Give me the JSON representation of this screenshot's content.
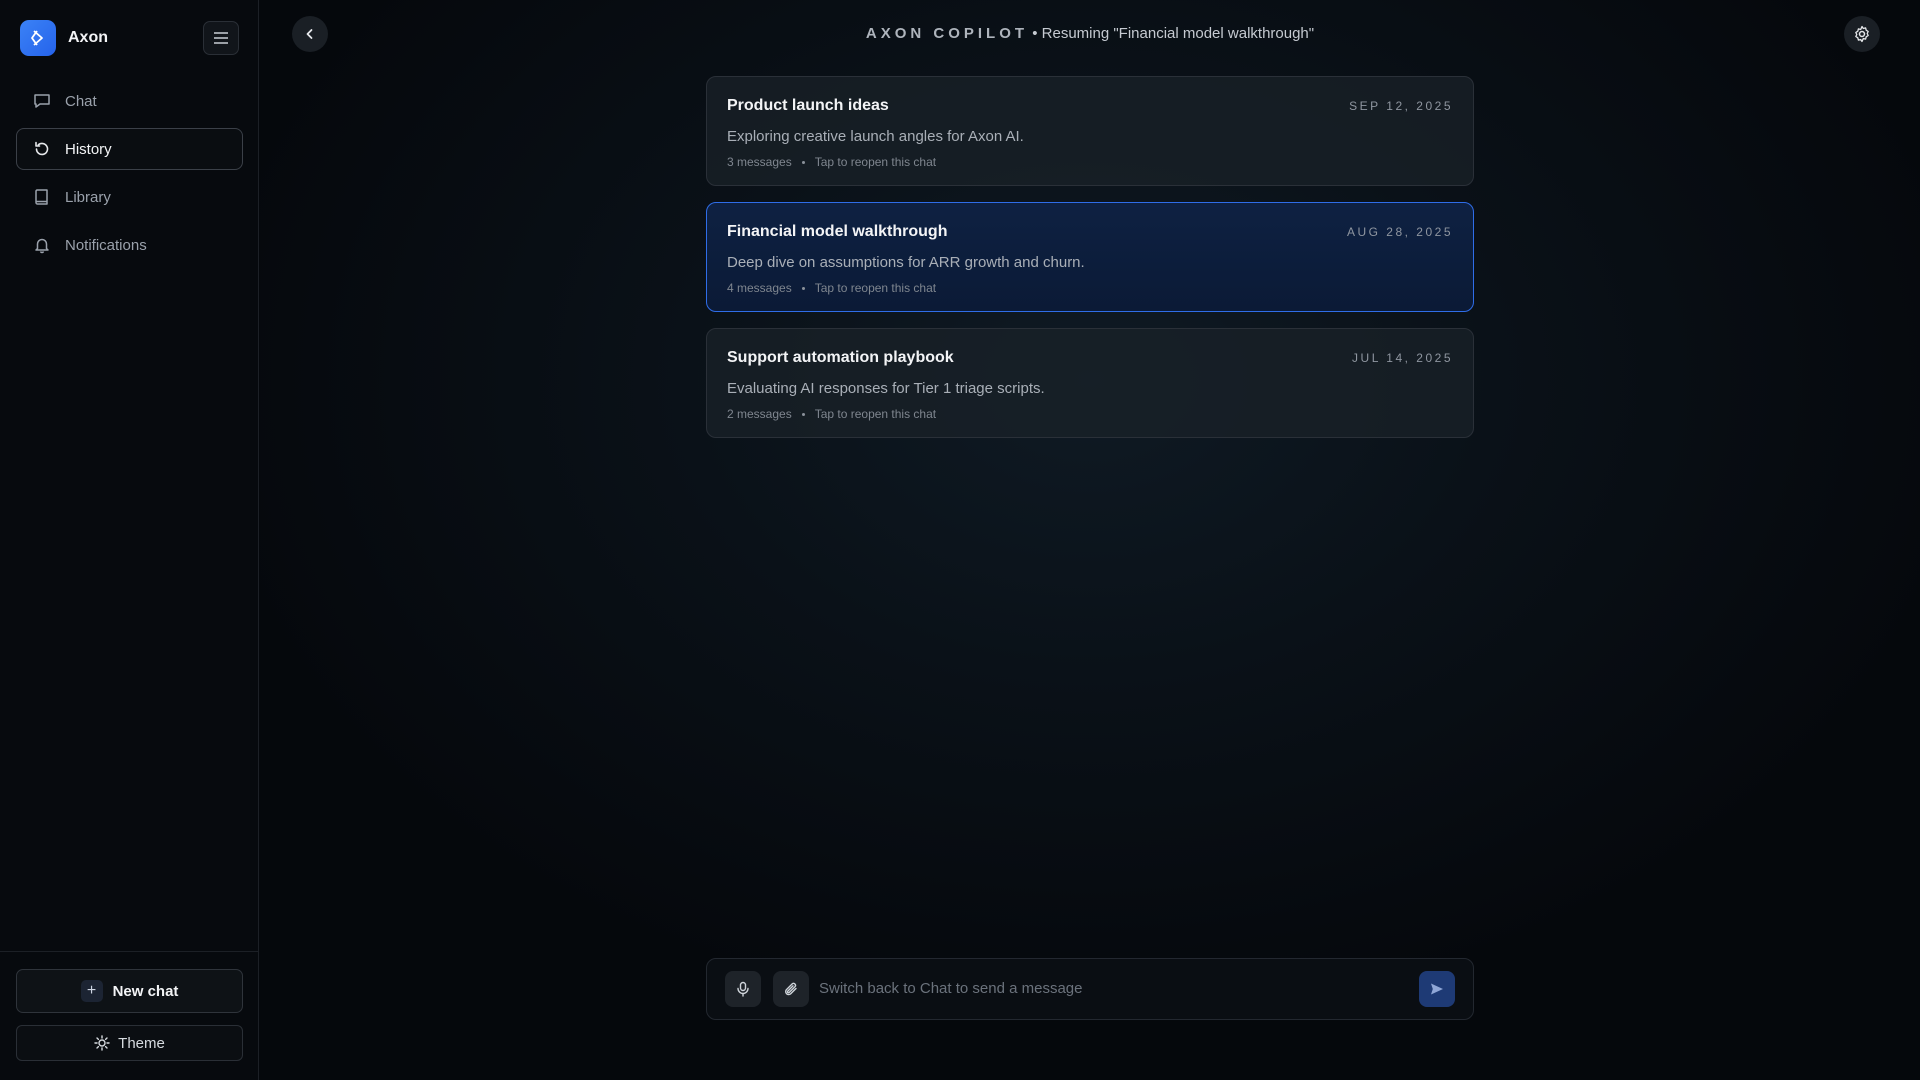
{
  "app": {
    "name": "Axon"
  },
  "sidebar": {
    "items": [
      {
        "label": "Chat",
        "icon": "chat-bubble-icon",
        "active": false
      },
      {
        "label": "History",
        "icon": "history-icon",
        "active": true
      },
      {
        "label": "Library",
        "icon": "book-icon",
        "active": false
      },
      {
        "label": "Notifications",
        "icon": "bell-icon",
        "active": false
      }
    ],
    "new_chat_label": "New chat",
    "theme_label": "Theme"
  },
  "header": {
    "brand": "AXON COPILOT",
    "separator": "•",
    "status": "Resuming \"Financial model walkthrough\""
  },
  "history": {
    "meta_hint": "Tap to reopen this chat",
    "items": [
      {
        "title": "Product launch ideas",
        "date": "SEP 12, 2025",
        "description": "Exploring creative launch angles for Axon AI.",
        "messages": "3 messages",
        "selected": false
      },
      {
        "title": "Financial model walkthrough",
        "date": "AUG 28, 2025",
        "description": "Deep dive on assumptions for ARR growth and churn.",
        "messages": "4 messages",
        "selected": true
      },
      {
        "title": "Support automation playbook",
        "date": "JUL 14, 2025",
        "description": "Evaluating AI responses for Tier 1 triage scripts.",
        "messages": "2 messages",
        "selected": false
      }
    ]
  },
  "composer": {
    "placeholder": "Switch back to Chat to send a message",
    "value": ""
  },
  "colors": {
    "accent": "#2f6de8",
    "logo": "#3b82f6",
    "background": "#05080c"
  }
}
